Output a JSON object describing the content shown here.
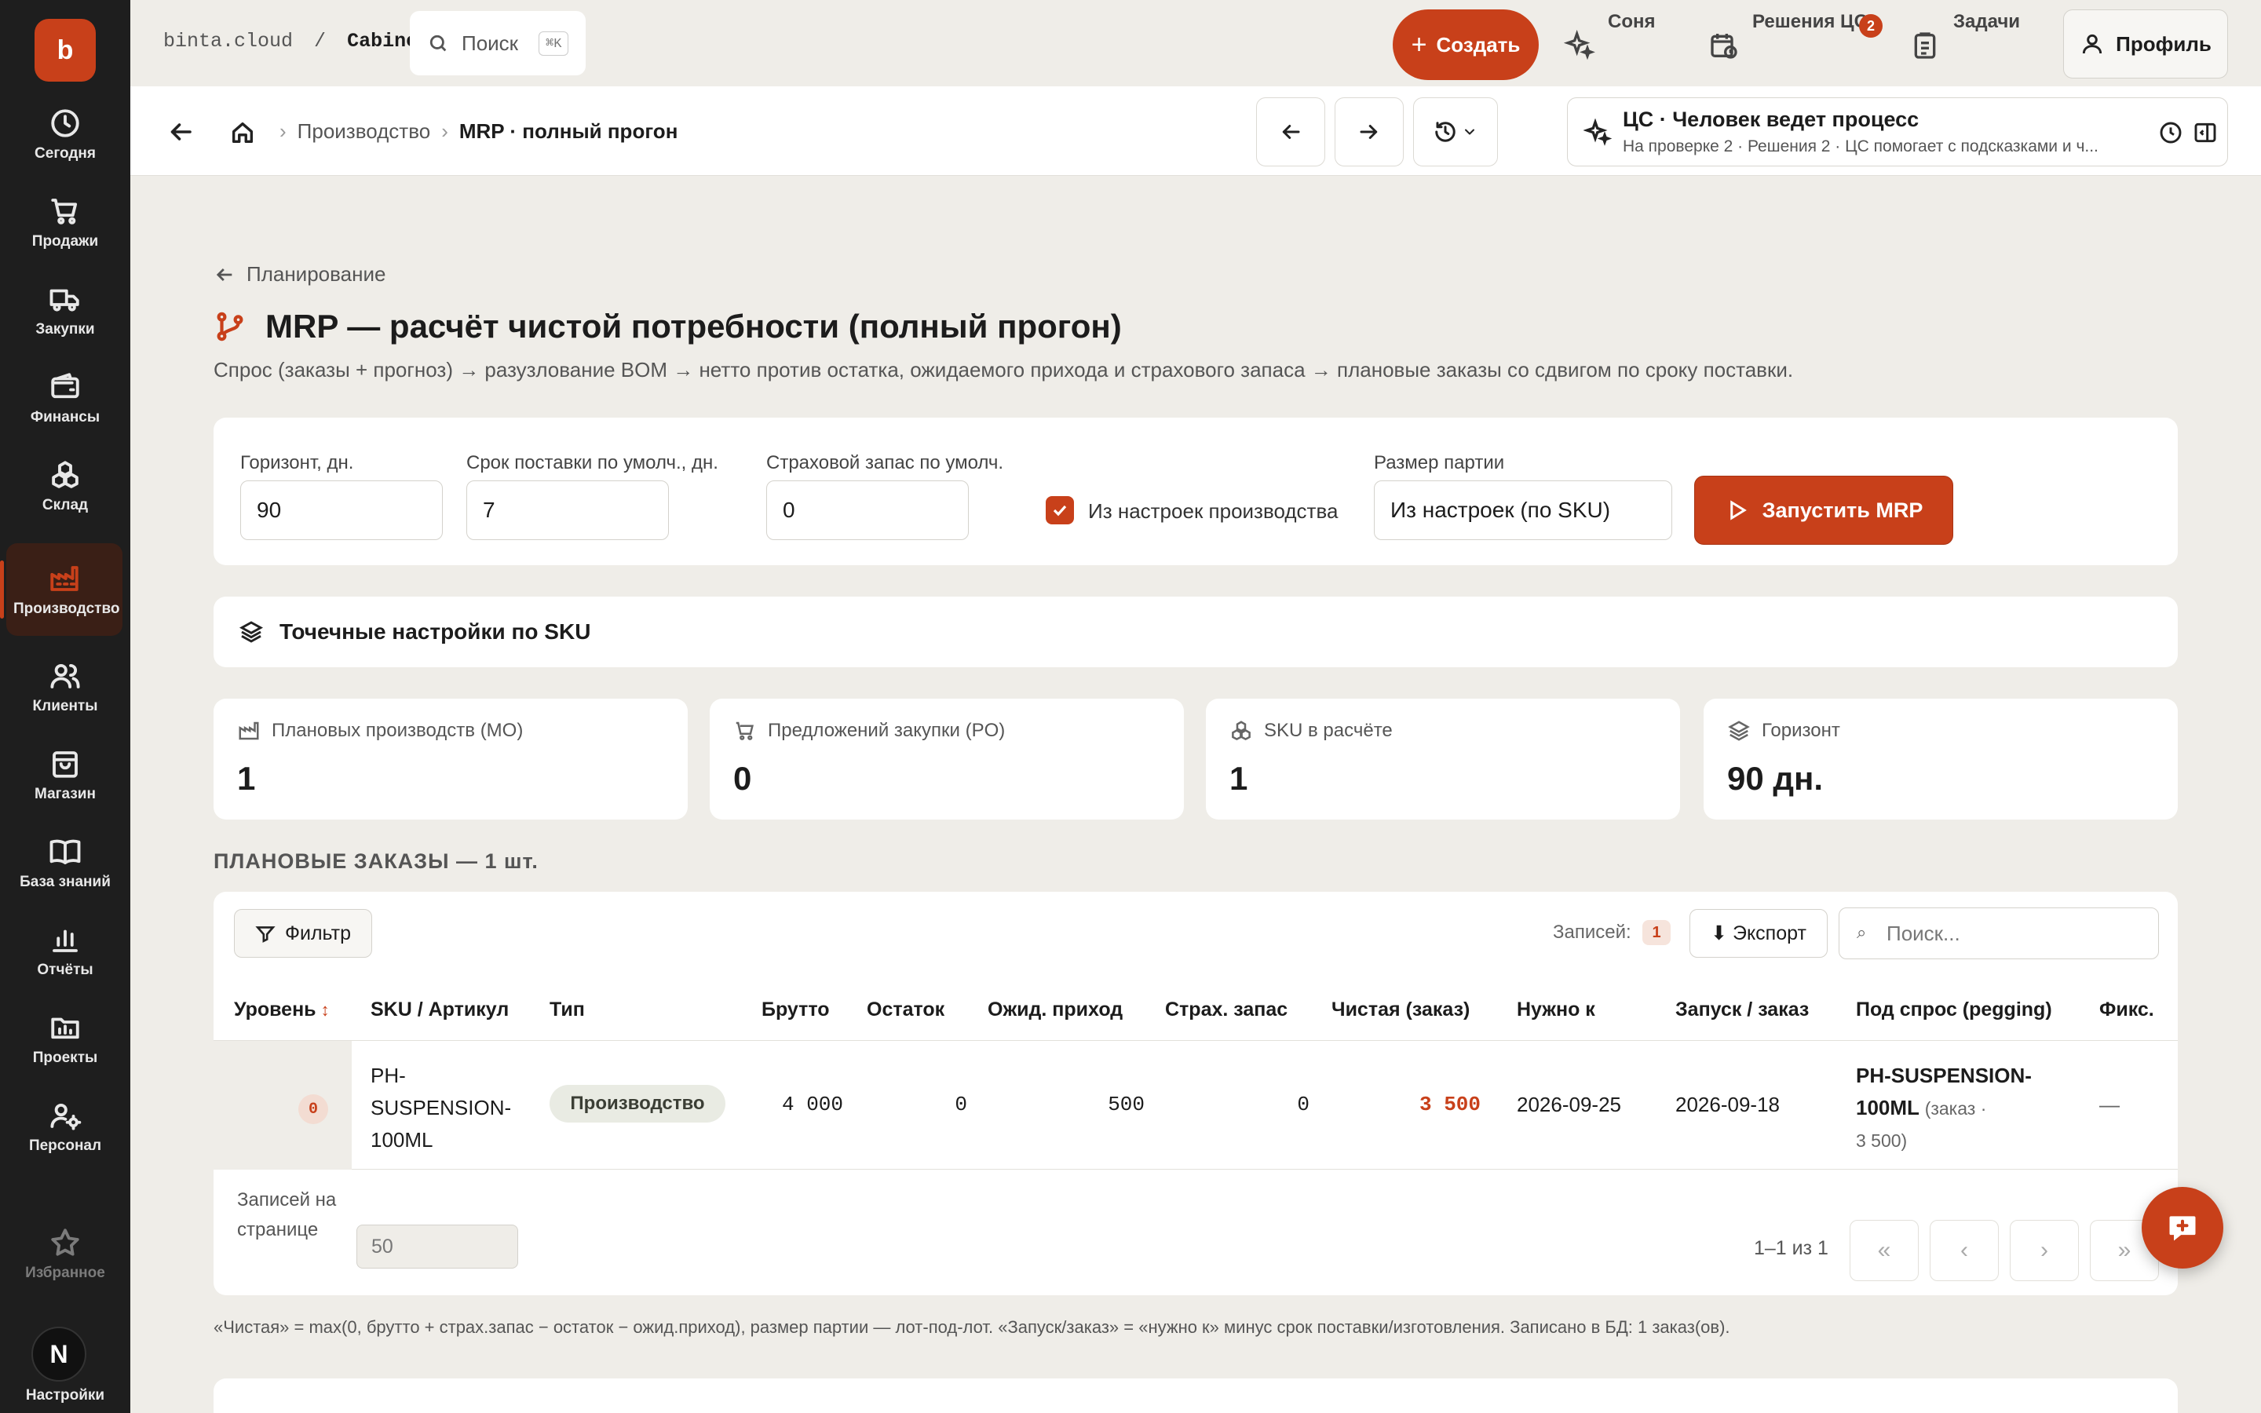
{
  "app": {
    "logo_letter": "b",
    "domain": "binta.cloud",
    "crumb_sep": "/",
    "section": "Cabinet",
    "brand_color": "#c8401a"
  },
  "sidebar": {
    "items": [
      {
        "label": "Сегодня",
        "icon": "clock-icon"
      },
      {
        "label": "Продажи",
        "icon": "cart-icon"
      },
      {
        "label": "Закупки",
        "icon": "truck-icon"
      },
      {
        "label": "Финансы",
        "icon": "wallet-icon"
      },
      {
        "label": "Склад",
        "icon": "boxes-icon"
      },
      {
        "label": "Производство",
        "icon": "factory-icon",
        "active": true
      },
      {
        "label": "Клиенты",
        "icon": "users-icon"
      },
      {
        "label": "Магазин",
        "icon": "bag-icon"
      },
      {
        "label": "База знаний",
        "icon": "book-icon"
      },
      {
        "label": "Отчёты",
        "icon": "chart-icon"
      },
      {
        "label": "Проекты",
        "icon": "folder-icon"
      },
      {
        "label": "Персонал",
        "icon": "user-gear-icon"
      },
      {
        "label": "Избранное",
        "icon": "star-icon"
      },
      {
        "label": "Настройки",
        "icon": "settings-icon"
      }
    ],
    "avatar_letter": "N"
  },
  "topbar": {
    "search_label": "Поиск",
    "search_kbd": "⌘K",
    "create_label": "Создать",
    "sonya_label": "Соня",
    "decisions_label": "Решения ЦС",
    "decisions_badge": "2",
    "tasks_label": "Задачи",
    "profile_label": "Профиль"
  },
  "subbar": {
    "breadcrumb_parent": "Производство",
    "breadcrumb_current": "MRP · полный прогон",
    "cs_title": "ЦС · Человек ведет процесс",
    "cs_subtitle": "На проверке 2 · Решения 2 · ЦС помогает с подсказками и ч..."
  },
  "page": {
    "back_label": "Планирование",
    "title": "MRP — расчёт чистой потребности (полный прогон)",
    "description": "Спрос (заказы + прогноз) → разузлование BOM → нетто против остатка, ожидаемого прихода и страхового запаса → плановые заказы со сдвигом по сроку поставки."
  },
  "params": {
    "horizon_label": "Горизонт, дн.",
    "horizon_value": "90",
    "lead_label": "Срок поставки по умолч., дн.",
    "lead_value": "7",
    "safety_label": "Страховой запас по умолч.",
    "safety_value": "0",
    "from_settings_label": "Из настроек производства",
    "from_settings_checked": true,
    "lot_label": "Размер партии",
    "lot_value": "Из настроек (по SKU)",
    "run_label": "Запустить MRP"
  },
  "sku_settings_label": "Точечные настройки по SKU",
  "stats": [
    {
      "label": "Плановых производств (MO)",
      "value": "1",
      "icon": "factory-icon"
    },
    {
      "label": "Предложений закупки (PO)",
      "value": "0",
      "icon": "cart-icon"
    },
    {
      "label": "SKU в расчёте",
      "value": "1",
      "icon": "boxes-icon"
    },
    {
      "label": "Горизонт",
      "value": "90 дн.",
      "icon": "layers-icon"
    }
  ],
  "orders": {
    "section_title": "ПЛАНОВЫЕ ЗАКАЗЫ — 1 шт.",
    "filter_label": "Фильтр",
    "records_label": "Записей:",
    "records_count": "1",
    "export_label": "⬇ Экспорт",
    "search_placeholder": "Поиск...",
    "columns": [
      "Уровень",
      "SKU / Артикул",
      "Тип",
      "Брутто",
      "Остаток",
      "Ожид. приход",
      "Страх. запас",
      "Чистая (заказ)",
      "Нужно к",
      "Запуск / заказ",
      "Под спрос (pegging)",
      "Фикс."
    ],
    "sort_indicator": "↕",
    "row": {
      "level": "0",
      "sku_line1": "PH-",
      "sku_line2": "SUSPENSION-",
      "sku_line3": "100ML",
      "type": "Производство",
      "gross": "4 000",
      "stock": "0",
      "incoming": "500",
      "safety": "0",
      "net": "3 500",
      "need_by": "2026-09-25",
      "launch": "2026-09-18",
      "pegging_line1": "PH-SUSPENSION-",
      "pegging_line2": "100ML",
      "pegging_note1": "(заказ ·",
      "pegging_note2": "3 500)",
      "fixed": "—"
    },
    "per_page_label": "Записей на странице",
    "per_page_value": "50",
    "page_info": "1–1 из 1",
    "first_page": "«",
    "prev_page": "‹",
    "next_page": "›",
    "last_page": "»"
  },
  "footnote": "«Чистая» = max(0, брутто + страх.запас − остаток − ожид.приход), размер партии — лот-под-лот. «Запуск/заказ» = «нужно к» минус срок поставки/изготовления. Записано в БД: 1 заказ(ов)."
}
